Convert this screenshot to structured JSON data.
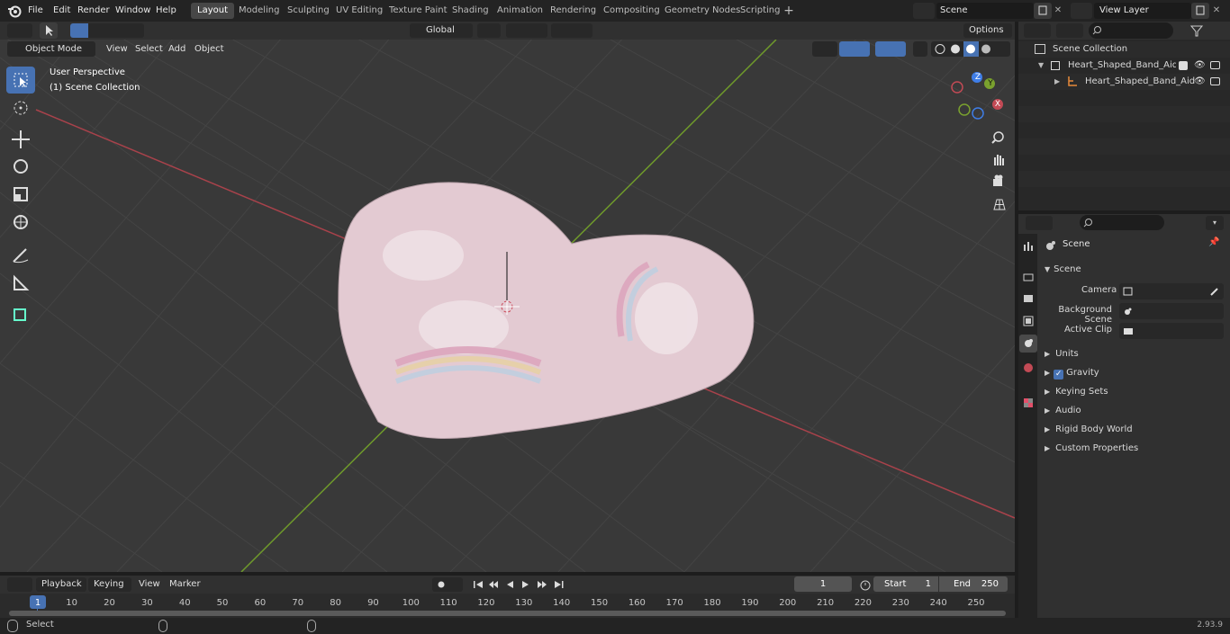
{
  "menu": {
    "items": [
      "File",
      "Edit",
      "Render",
      "Window",
      "Help"
    ]
  },
  "workspaces": {
    "tabs": [
      "Layout",
      "Modeling",
      "Sculpting",
      "UV Editing",
      "Texture Paint",
      "Shading",
      "Animation",
      "Rendering",
      "Compositing",
      "Geometry Nodes",
      "Scripting"
    ],
    "active": "Layout"
  },
  "scene_field": "Scene",
  "view_layer_field": "View Layer",
  "viewport_header": {
    "mode": "Object Mode",
    "menus": [
      "View",
      "Select",
      "Add",
      "Object"
    ],
    "transform": "Global",
    "options": "Options"
  },
  "viewport_overlay": {
    "perspective": "User Perspective",
    "collection": "(1) Scene Collection"
  },
  "gizmo": {
    "x": "X",
    "y": "Y",
    "z": "Z"
  },
  "outliner": {
    "root": "Scene Collection",
    "collection": "Heart_Shaped_Band_Aid_for_",
    "object": "Heart_Shaped_Band_Aid"
  },
  "properties": {
    "context": "Scene",
    "section": "Scene",
    "fields": [
      {
        "label": "Camera"
      },
      {
        "label": "Background Scene"
      },
      {
        "label": "Active Clip"
      }
    ],
    "panels": [
      "Units",
      "Gravity",
      "Keying Sets",
      "Audio",
      "Rigid Body World",
      "Custom Properties"
    ]
  },
  "timeline": {
    "menus": [
      "Playback",
      "Keying",
      "View",
      "Marker"
    ],
    "current_frame": "1",
    "start_label": "Start",
    "start": "1",
    "end_label": "End",
    "end": "250",
    "ticks": [
      "1",
      "10",
      "20",
      "30",
      "40",
      "50",
      "60",
      "70",
      "80",
      "90",
      "100",
      "110",
      "120",
      "130",
      "140",
      "150",
      "160",
      "170",
      "180",
      "190",
      "200",
      "210",
      "220",
      "230",
      "240",
      "250"
    ]
  },
  "status": {
    "left": "Select",
    "version": "2.93.9"
  },
  "colors": {
    "accent": "#4772b3",
    "x_axis": "#c24a55",
    "y_axis": "#7aa12e",
    "heart": "#e8cfd6"
  }
}
